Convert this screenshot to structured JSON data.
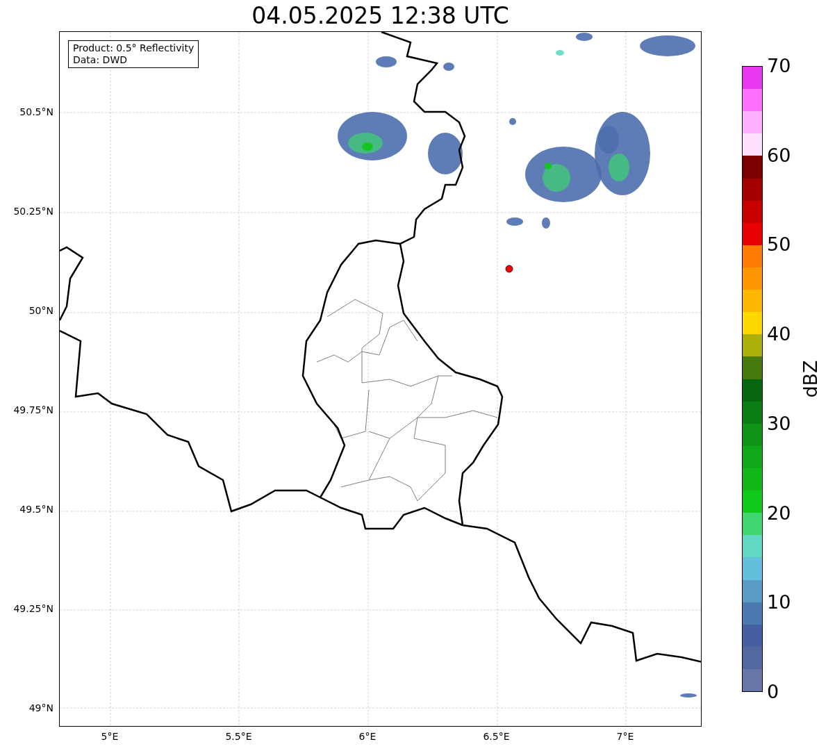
{
  "title": "04.05.2025 12:38 UTC",
  "info_box": [
    "Product: 0.5° Reflectivity",
    "Data: DWD"
  ],
  "lat_labels": [
    "50.5°N",
    "50.25°N",
    "50°N",
    "49.75°N",
    "49.5°N",
    "49.25°N",
    "49°N"
  ],
  "lon_labels": [
    "5°E",
    "5.5°E",
    "6°E",
    "6.5°E",
    "7°E"
  ],
  "colorbar": {
    "label": "dBZ",
    "ticks": [
      "70",
      "60",
      "50",
      "40",
      "30",
      "20",
      "10",
      "0"
    ],
    "bins": [
      {
        "color": "#e838f0"
      },
      {
        "color": "#ff70ff"
      },
      {
        "color": "#ffb0ff"
      },
      {
        "color": "#ffe0ff"
      },
      {
        "color": "#7c0000"
      },
      {
        "color": "#a40000"
      },
      {
        "color": "#c80000"
      },
      {
        "color": "#e80000"
      },
      {
        "color": "#ff7c00"
      },
      {
        "color": "#ff9800"
      },
      {
        "color": "#ffb800"
      },
      {
        "color": "#ffd800"
      },
      {
        "color": "#aeb00a"
      },
      {
        "color": "#467a0c"
      },
      {
        "color": "#086510"
      },
      {
        "color": "#0a7d14"
      },
      {
        "color": "#0e9416"
      },
      {
        "color": "#10a818"
      },
      {
        "color": "#12b818"
      },
      {
        "color": "#10c818"
      },
      {
        "color": "#3dd670"
      },
      {
        "color": "#5fd8c4"
      },
      {
        "color": "#62c0dc"
      },
      {
        "color": "#5a9cc4"
      },
      {
        "color": "#4a7ab0"
      },
      {
        "color": "#4560a2"
      },
      {
        "color": "#5468a0"
      },
      {
        "color": "#6677a8"
      }
    ]
  }
}
